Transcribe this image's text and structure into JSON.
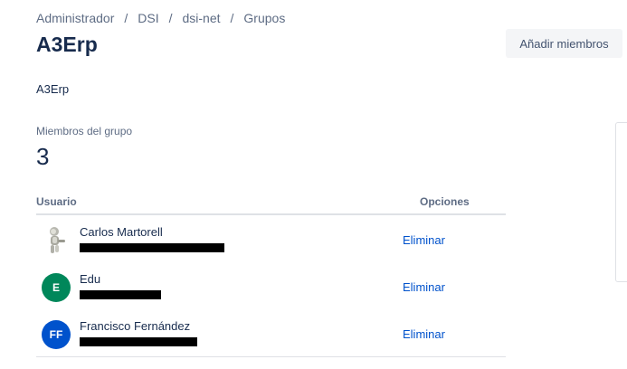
{
  "breadcrumb": [
    "Administrador",
    "DSI",
    "dsi-net",
    "Grupos"
  ],
  "page_title": "A3Erp",
  "add_members_label": "Añadir miembros",
  "description": "A3Erp",
  "members_label": "Miembros del grupo",
  "members_count": "3",
  "table": {
    "headers": {
      "user": "Usuario",
      "options": "Opciones"
    },
    "rows": [
      {
        "name": "Carlos Martorell",
        "avatar": "",
        "avatar_color": "",
        "remove_label": "Eliminar"
      },
      {
        "name": "Edu",
        "avatar": "E",
        "avatar_color": "#00875a",
        "remove_label": "Eliminar"
      },
      {
        "name": "Francisco Fernández",
        "avatar": "FF",
        "avatar_color": "#0052cc",
        "remove_label": "Eliminar"
      }
    ]
  }
}
